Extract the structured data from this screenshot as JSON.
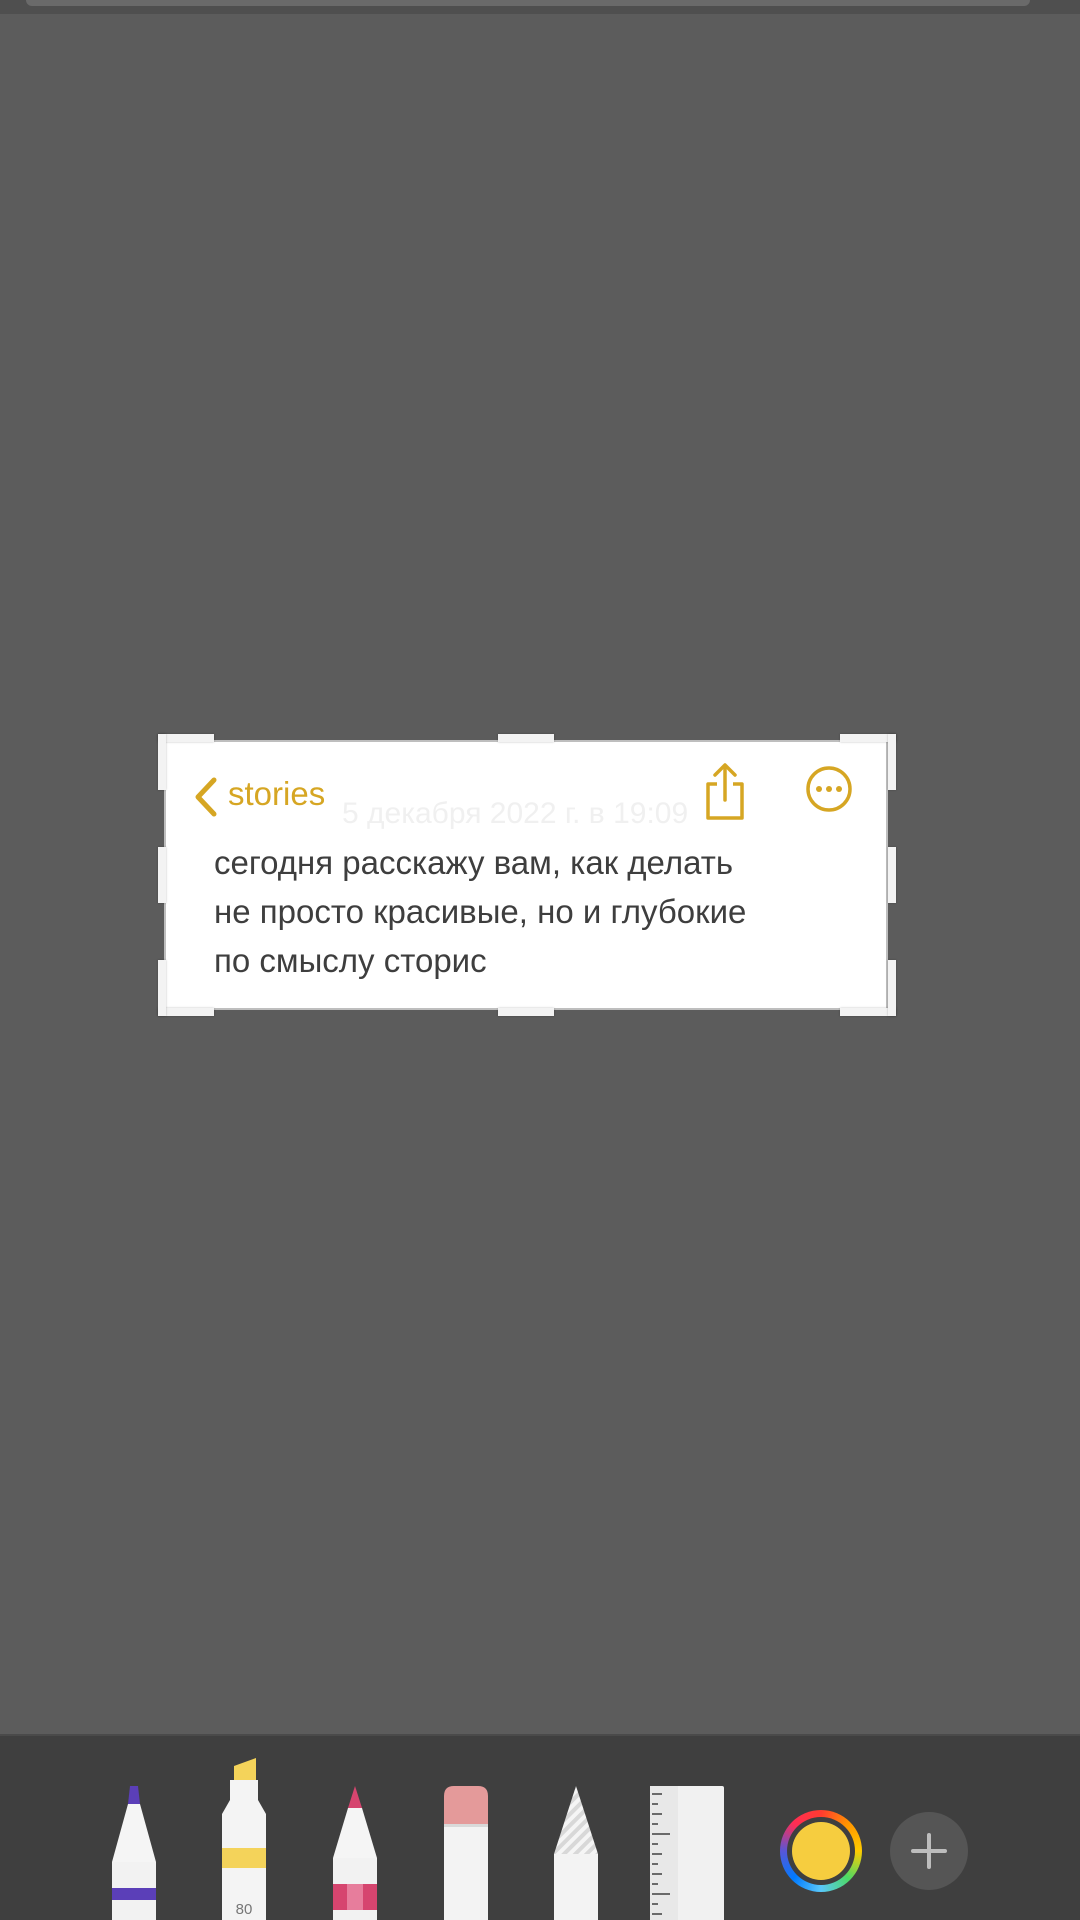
{
  "note": {
    "back_label": "stories",
    "ghost_date": "5 декабря 2022 г. в 19:09",
    "body_lines": [
      "сегодня расскажу вам, как делать",
      "не просто красивые, но и глубокие",
      "по смыслу сторис"
    ],
    "accent_color": "#d6a623"
  },
  "toolbar": {
    "tools": [
      {
        "name": "pen",
        "tip_color": "#5b3fb8"
      },
      {
        "name": "marker",
        "tip_color": "#f4d35a",
        "label": "80"
      },
      {
        "name": "pencil",
        "tip_color": "#d6456f"
      },
      {
        "name": "eraser",
        "tip_color": "#e49a9a"
      },
      {
        "name": "lasso"
      },
      {
        "name": "ruler"
      }
    ],
    "selected_color": "#f6cd3f"
  }
}
